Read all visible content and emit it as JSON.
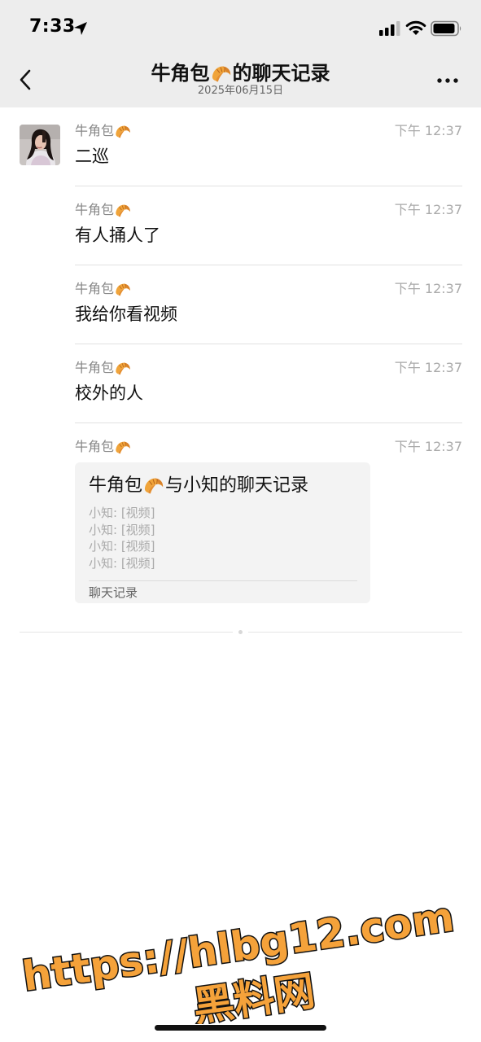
{
  "status_bar": {
    "time": "7:33"
  },
  "nav": {
    "title_prefix": "牛角包",
    "title_suffix": "的聊天记录",
    "subtitle": "2025年06月15日",
    "title_emoji": "croissant"
  },
  "messages": [
    {
      "sender": "牛角包",
      "time": "下午 12:37",
      "text": "二巡"
    },
    {
      "sender": "牛角包",
      "time": "下午 12:37",
      "text": "有人捅人了"
    },
    {
      "sender": "牛角包",
      "time": "下午 12:37",
      "text": "我给你看视频"
    },
    {
      "sender": "牛角包",
      "time": "下午 12:37",
      "text": "校外的人"
    },
    {
      "sender": "牛角包",
      "time": "下午 12:37",
      "text": ""
    }
  ],
  "chat_record_card": {
    "title_prefix": "牛角包",
    "title_suffix": "与小知的聊天记录",
    "lines": [
      "小知: [视频]",
      "小知: [视频]",
      "小知: [视频]",
      "小知: [视频]"
    ],
    "footer": "聊天记录"
  },
  "watermark": {
    "line1": "https://hlbg12.com",
    "line2": "黑料网"
  },
  "colors": {
    "bar_background": "#ededed",
    "watermark_fill": "#f5a23a",
    "watermark_stroke": "#111111"
  }
}
